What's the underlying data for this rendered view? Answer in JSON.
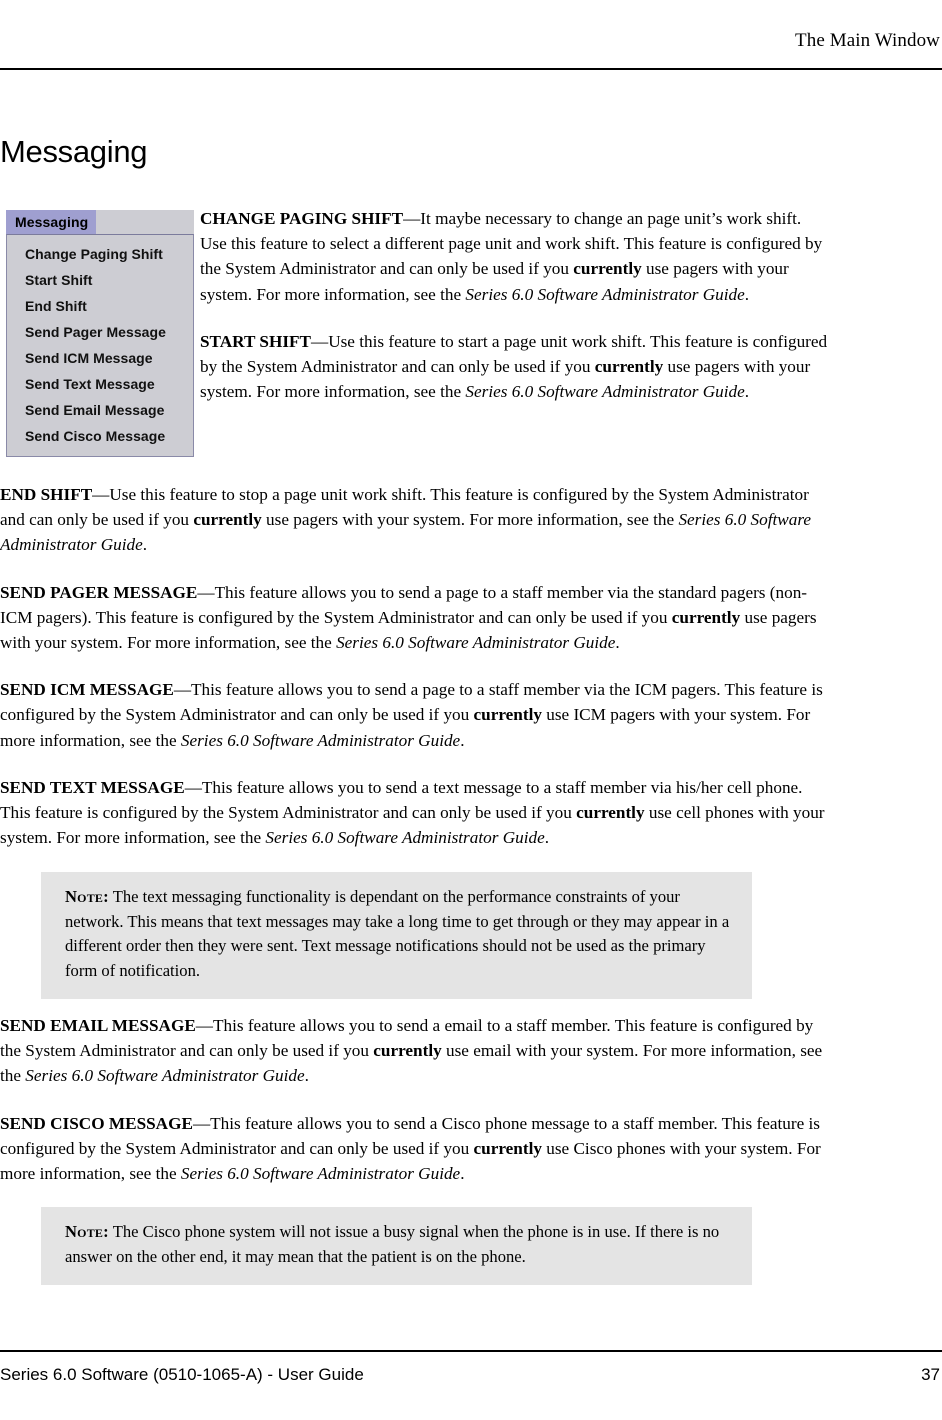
{
  "header": {
    "running_head": "The Main Window"
  },
  "section": {
    "title": "Messaging"
  },
  "menu_screenshot": {
    "menubar_tab_label": "Messaging",
    "tab_background": "#9f9fd0",
    "menubar_background": "#cdcdd3",
    "menu_background": "#cdcdd3",
    "menu_border": "#8a8aa8",
    "items": [
      {
        "label": "Change Paging Shift"
      },
      {
        "label": "Start Shift"
      },
      {
        "label": "End Shift"
      },
      {
        "label": "Send Pager Message"
      },
      {
        "label": "Send ICM Message"
      },
      {
        "label": "Send Text Message"
      },
      {
        "label": "Send Email Message"
      },
      {
        "label": "Send Cisco Message"
      }
    ]
  },
  "paragraphs": {
    "change_paging_shift": {
      "lead": "CHANGE PAGING SHIFT",
      "t1": "—It maybe necessary to change an page unit’s work shift. Use this feature to select a different page unit and work shift. This feature is configured by the System Administrator and can only be used if you ",
      "bold1": "currently",
      "t2": " use pagers with your system. For more information, see the ",
      "italic1": "Series 6.0 Software Administrator Guide",
      "t3": "."
    },
    "start_shift": {
      "lead": "START SHIFT",
      "t1": "—Use this feature to start a page unit work shift. This feature is configured by the System Administrator and can only be used if you ",
      "bold1": "currently",
      "t2": " use pagers with your system. For more information, see the ",
      "italic1": "Series 6.0 Software Administrator Guide",
      "t3": "."
    },
    "end_shift": {
      "lead": "END SHIFT",
      "t1": "—Use this feature to stop a page unit work shift. This feature is configured by the System Administrator and can only be used if you ",
      "bold1": "currently",
      "t2": " use pagers with your system. For more information, see the ",
      "italic1": "Series 6.0 Software Administrator Guide",
      "t3": "."
    },
    "send_pager_message": {
      "lead": "SEND PAGER MESSAGE",
      "t1": "—This feature allows you to send a page to a staff member via the standard pagers (non-ICM pagers). This feature is configured by the System Administrator and can only be used if you ",
      "bold1": "currently",
      "t2": " use pagers with your system. For more information, see the ",
      "italic1": "Series 6.0 Software Administrator Guide",
      "t3": "."
    },
    "send_icm_message": {
      "lead": "SEND ICM MESSAGE",
      "t1": "—This feature allows you to send a page to a staff member via the ICM pagers. This feature is configured by the System Administrator and can only be used if you ",
      "bold1": "currently",
      "t2": " use ICM pagers with your system. For more information, see the ",
      "italic1": "Series 6.0 Software Administrator Guide",
      "t3": "."
    },
    "send_text_message": {
      "lead": "SEND TEXT MESSAGE",
      "t1": "—This feature allows you to send a text message to a staff member via his/her cell phone. This feature is configured by the System Administrator and can only be used if you ",
      "bold1": "currently",
      "t2": " use cell phones with your system. For more information, see the ",
      "italic1": "Series 6.0 Software Administrator Guide",
      "t3": "."
    },
    "send_email_message": {
      "lead": "SEND EMAIL MESSAGE",
      "t1": "—This feature allows you to send a email to a staff member. This feature is configured by the System Administrator and can only be used if you ",
      "bold1": "currently",
      "t2": " use email with your system. For more information, see the ",
      "italic1": "Series 6.0 Software Administrator Guide",
      "t3": "."
    },
    "send_cisco_message": {
      "lead": "SEND CISCO MESSAGE",
      "t1": "—This feature allows you to send a Cisco phone message to a staff member. This feature is configured by the System Administrator and can only be used if you ",
      "bold1": "currently",
      "t2": " use Cisco phones with your system. For more information, see the ",
      "italic1": "Series 6.0 Software Administrator Guide",
      "t3": "."
    }
  },
  "notes": [
    {
      "label": "Note:",
      "text": " The text messaging functionality is dependant on the performance constraints of your network. This means that text messages may take a long time to get through or they may appear in a different order then they were sent. Text message notifications should not be used as the primary form of notification.",
      "background": "#e4e4e4"
    },
    {
      "label": "Note:",
      "text": " The Cisco phone system will not issue a busy signal when the phone is in use. If there is no answer on the other end, it may mean that the patient is on the phone.",
      "background": "#e4e4e4"
    }
  ],
  "footer": {
    "left": "Series 6.0 Software (0510-1065-A) - User Guide",
    "page_number": "37"
  }
}
